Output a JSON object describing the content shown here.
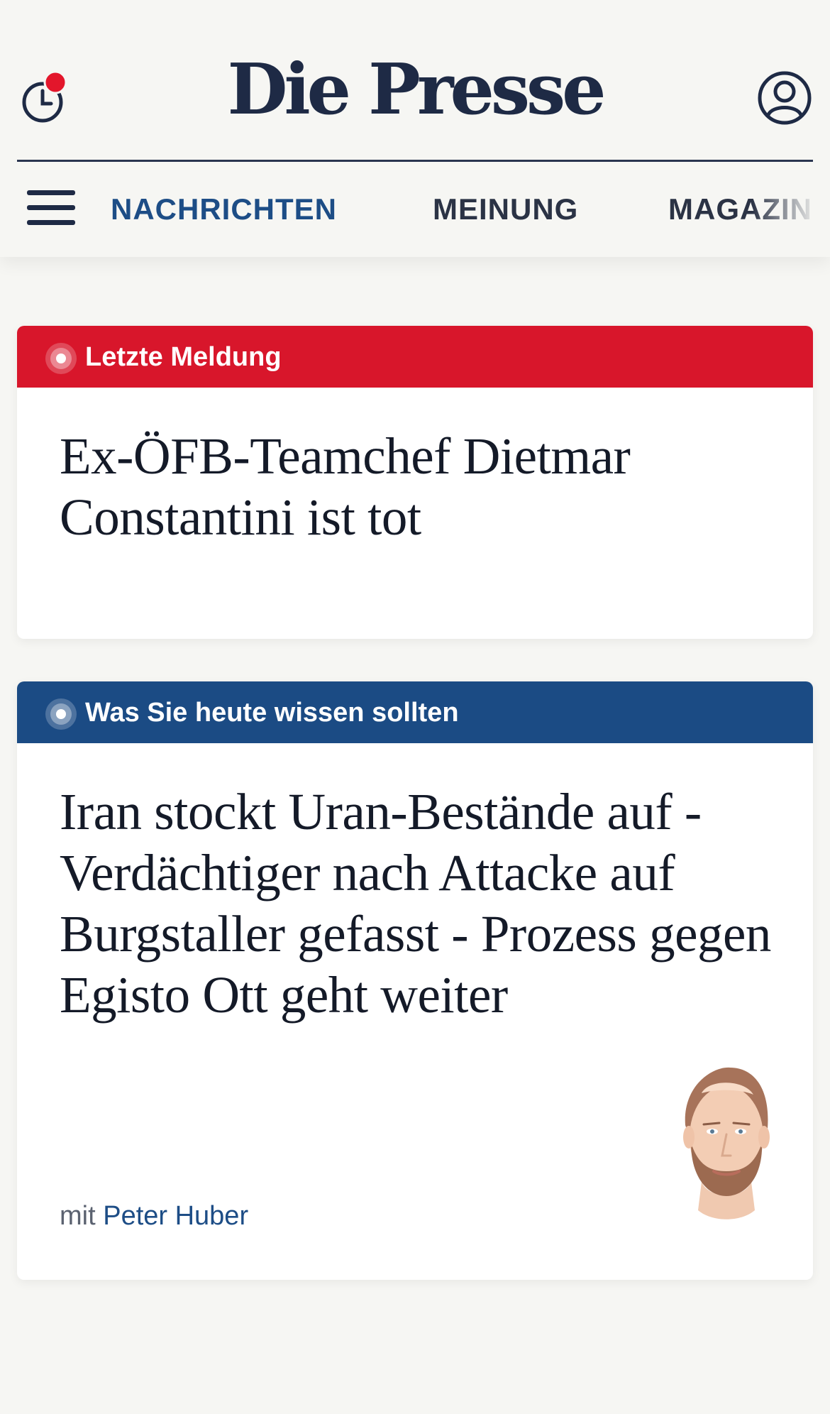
{
  "header": {
    "logo": "Die Presse",
    "clock_icon": "clock-icon",
    "notification_dot_color": "#e3162b",
    "user_icon": "user-account-icon"
  },
  "nav": {
    "menu_icon": "hamburger-menu-icon",
    "items": [
      {
        "label": "NACHRICHTEN",
        "active": true
      },
      {
        "label": "MEINUNG",
        "active": false
      },
      {
        "label": "MAGAZIN",
        "active": false
      }
    ],
    "active_color": "#1d4d86"
  },
  "cards": [
    {
      "label": "Letzte Meldung",
      "color": "#d8162b",
      "headline": "Ex-ÖFB-Teamchef Dietmar Constantini ist tot"
    },
    {
      "label": "Was Sie heute wissen sollten",
      "color": "#1b4b84",
      "headline": "Iran stockt Uran-Bestände auf - Verdächtiger nach Attacke auf Burgstaller gefasst - Prozess gegen Egisto Ott geht weiter",
      "byline_prefix": "mit",
      "author": "Peter Huber",
      "portrait_icon": "author-portrait-illustration"
    }
  ]
}
